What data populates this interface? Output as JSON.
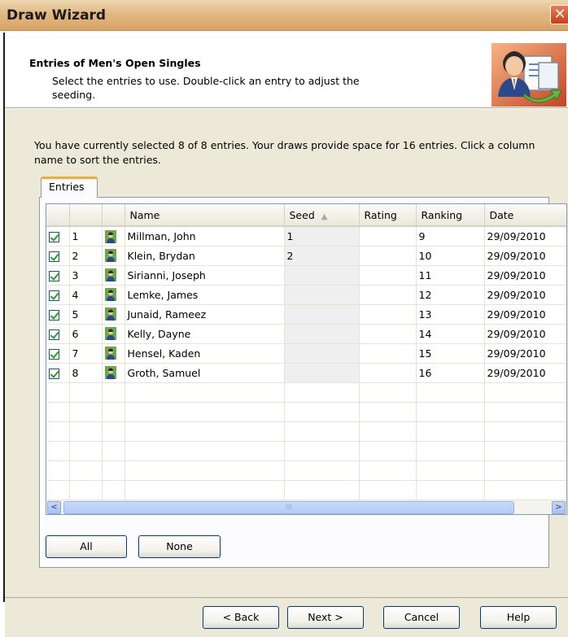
{
  "window": {
    "title": "Draw Wizard",
    "close_glyph": "✕"
  },
  "header": {
    "title": "Entries of Men's Open Singles",
    "subtitle": "Select the entries to use. Double-click an entry to adjust the seeding.",
    "icon": "user-document-wizard-icon"
  },
  "info_text": "You have currently selected 8 of 8 entries. Your draws provide space for 16 entries. Click a column name to sort the entries.",
  "tabs": [
    {
      "label": "Entries",
      "active": true
    }
  ],
  "grid": {
    "columns": [
      "",
      "",
      "",
      "Name",
      "Seed",
      "Rating",
      "Ranking",
      "Date"
    ],
    "sort_column": "Seed",
    "rows": [
      {
        "checked": true,
        "index": "1",
        "name": "Millman, John",
        "seed": "1",
        "rating": "",
        "ranking": "9",
        "date": "29/09/2010"
      },
      {
        "checked": true,
        "index": "2",
        "name": "Klein, Brydan",
        "seed": "2",
        "rating": "",
        "ranking": "10",
        "date": "29/09/2010"
      },
      {
        "checked": true,
        "index": "3",
        "name": "Sirianni, Joseph",
        "seed": "",
        "rating": "",
        "ranking": "11",
        "date": "29/09/2010"
      },
      {
        "checked": true,
        "index": "4",
        "name": "Lemke, James",
        "seed": "",
        "rating": "",
        "ranking": "12",
        "date": "29/09/2010"
      },
      {
        "checked": true,
        "index": "5",
        "name": "Junaid, Rameez",
        "seed": "",
        "rating": "",
        "ranking": "13",
        "date": "29/09/2010"
      },
      {
        "checked": true,
        "index": "6",
        "name": "Kelly, Dayne",
        "seed": "",
        "rating": "",
        "ranking": "14",
        "date": "29/09/2010"
      },
      {
        "checked": true,
        "index": "7",
        "name": "Hensel, Kaden",
        "seed": "",
        "rating": "",
        "ranking": "15",
        "date": "29/09/2010"
      },
      {
        "checked": true,
        "index": "8",
        "name": "Groth, Samuel",
        "seed": "",
        "rating": "",
        "ranking": "16",
        "date": "29/09/2010"
      }
    ],
    "empty_rows": 7
  },
  "scrollbar": {
    "left_glyph": "<",
    "right_glyph": ">",
    "grip": "III"
  },
  "panel_buttons": {
    "all": "All",
    "none": "None"
  },
  "footer_buttons": {
    "back": "< Back",
    "next": "Next >",
    "cancel": "Cancel",
    "help": "Help"
  }
}
